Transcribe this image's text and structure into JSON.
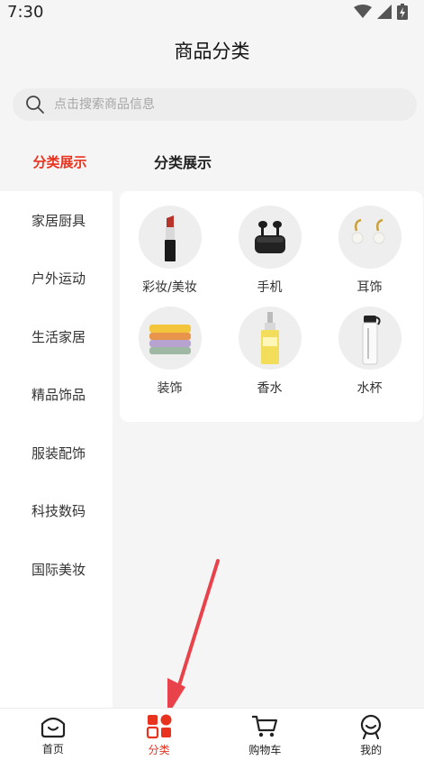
{
  "status_bar": {
    "time": "7:30",
    "icons": [
      "wifi-icon",
      "signal-icon",
      "battery-icon"
    ]
  },
  "header": {
    "title": "商品分类"
  },
  "search": {
    "placeholder": "点击搜索商品信息",
    "icon": "search-icon"
  },
  "tabs": [
    {
      "label": "分类展示",
      "active": true
    },
    {
      "label": "分类展示",
      "active": false
    }
  ],
  "sidebar": {
    "items": [
      {
        "label": "家居厨具"
      },
      {
        "label": "户外运动"
      },
      {
        "label": "生活家居"
      },
      {
        "label": "精品饰品"
      },
      {
        "label": "服装配饰"
      },
      {
        "label": "科技数码"
      },
      {
        "label": "国际美妆"
      }
    ]
  },
  "categories": {
    "items": [
      {
        "label": "彩妆/美妆",
        "icon": "lipstick-image"
      },
      {
        "label": "手机",
        "icon": "earbuds-image"
      },
      {
        "label": "耳饰",
        "icon": "earrings-image"
      },
      {
        "label": "装饰",
        "icon": "towels-image"
      },
      {
        "label": "香水",
        "icon": "lotion-bottle-image"
      },
      {
        "label": "水杯",
        "icon": "water-bottle-image"
      }
    ]
  },
  "bottom_nav": {
    "items": [
      {
        "label": "首页",
        "icon": "home-icon",
        "active": false
      },
      {
        "label": "分类",
        "icon": "category-icon",
        "active": true
      },
      {
        "label": "购物车",
        "icon": "cart-icon",
        "active": false
      },
      {
        "label": "我的",
        "icon": "profile-icon",
        "active": false
      }
    ]
  },
  "colors": {
    "accent": "#e8331f",
    "background": "#f5f5f5",
    "annotation_arrow": "#e8424a"
  }
}
